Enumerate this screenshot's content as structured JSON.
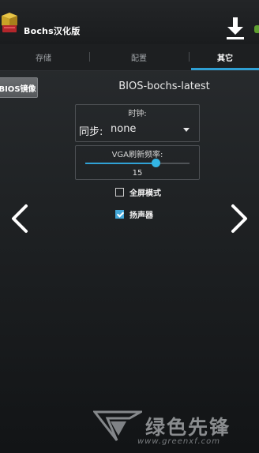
{
  "app": {
    "title": "Bochs汉化版"
  },
  "tabs": [
    {
      "label": "存储",
      "active": false
    },
    {
      "label": "配置",
      "active": false
    },
    {
      "label": "其它",
      "active": true
    }
  ],
  "bios": {
    "button_label": "BIOS镜像",
    "value": "BIOS-bochs-latest"
  },
  "clock": {
    "label": "时钟:",
    "sync_label": "同步:",
    "sync_value": "none"
  },
  "vga": {
    "label": "VGA刷新频率:",
    "value": "15",
    "slider_fraction": 0.68
  },
  "options": [
    {
      "label": "全屏模式",
      "checked": false
    },
    {
      "label": "扬声器",
      "checked": true
    }
  ],
  "icons": {
    "app": "app-logo-icon",
    "download": "download-icon",
    "prev": "chevron-left-icon",
    "next": "chevron-right-icon"
  },
  "colors": {
    "accent": "#33b5e5",
    "tab_indicator": "#2f9fd3",
    "checked": "#43a7d8"
  },
  "watermark": {
    "brand": "绿色先锋",
    "url": "www.greenxf.com"
  }
}
